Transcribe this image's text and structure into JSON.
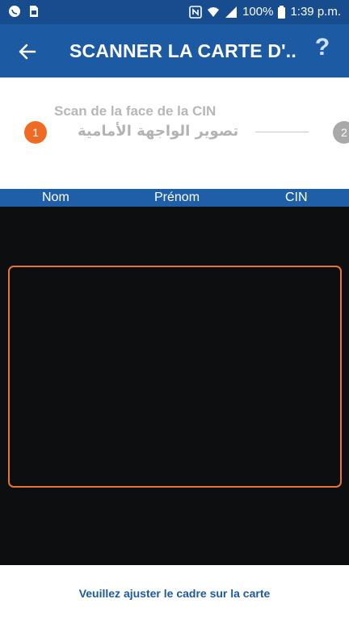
{
  "status_bar": {
    "battery": "100%",
    "time": "1:39 p.m.",
    "icons": [
      "whatsapp-icon",
      "sim-icon",
      "nfc-icon",
      "wifi-icon",
      "signal-icon",
      "battery-icon"
    ]
  },
  "app_bar": {
    "title": "SCANNER LA CARTE D'...",
    "help_label": "?",
    "back_icon": "arrow-left-icon"
  },
  "stepper": {
    "step1_number": "1",
    "step1_title_fr": "Scan de la face de la CIN",
    "step1_title_ar": "تصوير الواجهة الأمامية",
    "step2_number": "2"
  },
  "columns": {
    "nom": "Nom",
    "prenom": "Prénom",
    "cin": "CIN"
  },
  "hint": "Veuillez ajuster le cadre sur la carte",
  "colors": {
    "primary": "#1c5aa3",
    "accent": "#f06a24",
    "camera_bg": "#0d0e10"
  }
}
